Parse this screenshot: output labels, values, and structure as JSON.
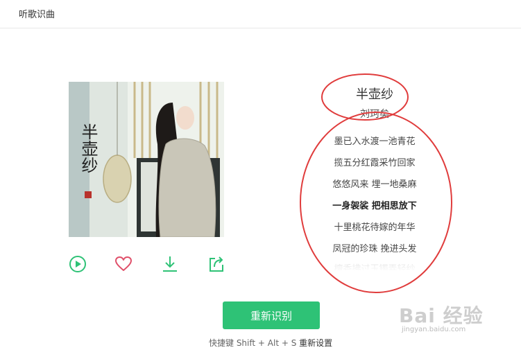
{
  "app": {
    "title": "听歌识曲"
  },
  "song": {
    "title": "半壶纱",
    "artist": "刘珂矣",
    "cover_calligraphy": "半壶纱"
  },
  "lyrics": [
    {
      "text": "墨已入水渡一池青花",
      "state": "normal"
    },
    {
      "text": "揽五分红霞采竹回家",
      "state": "normal"
    },
    {
      "text": "悠悠风来 埋一地桑麻",
      "state": "normal"
    },
    {
      "text": "一身袈裟  把相思放下",
      "state": "active"
    },
    {
      "text": "十里桃花待嫁的年华",
      "state": "normal"
    },
    {
      "text": "凤冠的珍珠 挽进头发",
      "state": "normal"
    },
    {
      "text": "檀香拂过玉镯弄轻纱",
      "state": "fade"
    }
  ],
  "actions": {
    "play": "play-icon",
    "like": "heart-icon",
    "download": "download-icon",
    "share": "share-icon"
  },
  "button": {
    "recognize_again": "重新识别"
  },
  "hint": {
    "prefix": "快捷键 Shift + Alt + S",
    "link": "重新设置"
  },
  "watermark": {
    "brand": "Bai 经验",
    "url": "jingyan.baidu.com"
  },
  "colors": {
    "accent": "#2ec276",
    "like": "#e0506a",
    "annotation": "#e03c3c"
  }
}
